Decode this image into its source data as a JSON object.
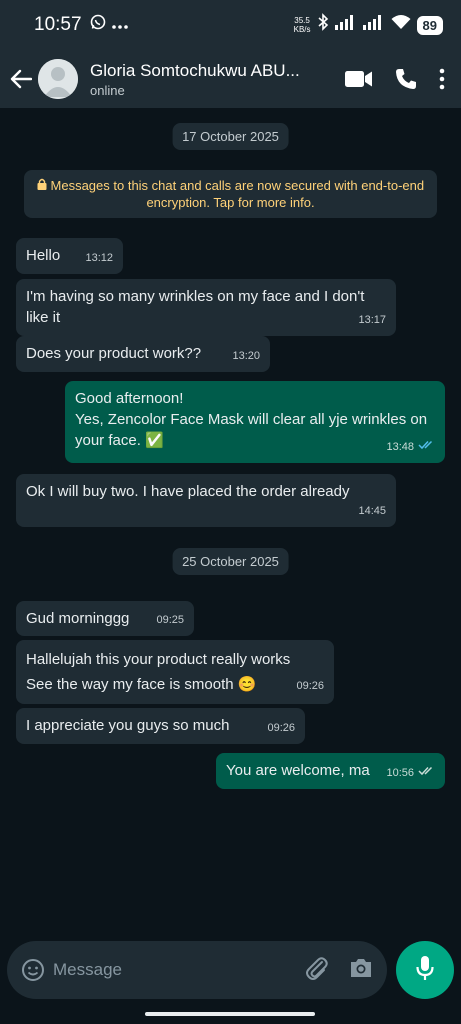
{
  "status_bar": {
    "time": "10:57",
    "net_speed_value": "35.5",
    "net_speed_unit": "KB/s",
    "battery": "89",
    "icons": [
      "whatsapp-icon",
      "more-dots-icon",
      "bluetooth-icon",
      "signal-icon",
      "signal-icon",
      "wifi-icon",
      "battery-icon"
    ]
  },
  "header": {
    "contact_name": "Gloria Somtochukwu ABU...",
    "status": "online",
    "icons": [
      "back-arrow-icon",
      "avatar",
      "video-call-icon",
      "phone-icon",
      "more-vert-icon"
    ]
  },
  "chat": {
    "date_1": "17 October 2025",
    "encryption_notice": "Messages to this chat and calls are now secured with end-to-end encryption. Tap for more info.",
    "messages": [
      {
        "dir": "in",
        "text": "Hello",
        "time": "13:12"
      },
      {
        "dir": "in",
        "text": "I'm having so many wrinkles on my face and I don't like it",
        "time": "13:17"
      },
      {
        "dir": "in",
        "text": "Does your product work??",
        "time": "13:20"
      },
      {
        "dir": "out",
        "line1": "Good afternoon!",
        "line2": "Yes, Zencolor Face Mask will clear all yje wrinkles on",
        "line3": "your face. ✅",
        "time": "13:48",
        "status": "read"
      },
      {
        "dir": "in",
        "text": "Ok I will buy two. I have placed the order already",
        "time": "14:45"
      },
      {
        "dir": "in",
        "text": "Gud morninggg",
        "time": "09:25"
      },
      {
        "dir": "in",
        "line1": "Hallelujah this your product really works",
        "line2": "See the way my face is smooth 😊",
        "time": "09:26"
      },
      {
        "dir": "in",
        "text": "I appreciate you guys so much",
        "time": "09:26"
      },
      {
        "dir": "out",
        "text": "You are welcome, ma",
        "time": "10:56",
        "status": "delivered"
      }
    ],
    "date_2": "25 October 2025"
  },
  "composer": {
    "placeholder": "Message",
    "icons": [
      "emoji-icon",
      "attach-icon",
      "camera-icon",
      "mic-icon"
    ]
  },
  "colors": {
    "background": "#0b141a",
    "bar": "#1f2c34",
    "incoming": "#1f2c34",
    "outgoing": "#005c4b",
    "accent": "#00a884",
    "encryption_text": "#ffd279",
    "read_ticks": "#53bdeb"
  }
}
